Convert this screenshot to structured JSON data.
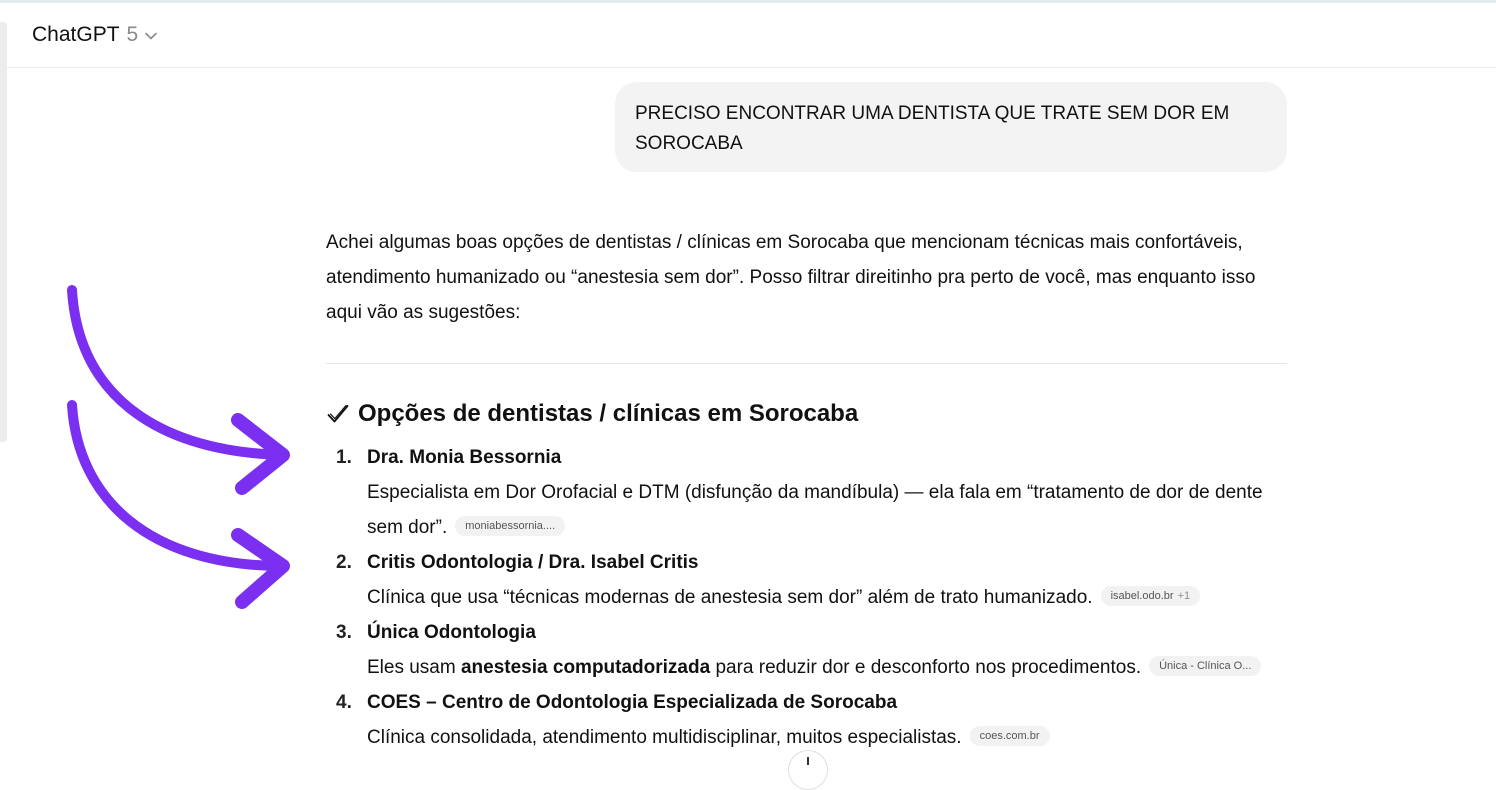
{
  "header": {
    "model_name": "ChatGPT",
    "model_version": "5",
    "dropdown_icon": "chevron-down-icon"
  },
  "conversation": {
    "user_message": "PRECISO ENCONTRAR UMA DENTISTA QUE TRATE SEM DOR EM SOROCABA",
    "intro": "Achei algumas boas opções de dentistas / clínicas em Sorocaba que mencionam técnicas mais confortáveis, atendimento humanizado ou “anestesia sem dor”. Posso filtrar direitinho pra perto de você, mas enquanto isso aqui vão as sugestões:",
    "section_title": "Opções de dentistas / clínicas em Sorocaba",
    "section_icon": "check-icon",
    "items": [
      {
        "number": "1.",
        "name": "Dra. Monia Bessornia",
        "desc": "Especialista em Dor Orofacial e DTM (disfunção da mandíbula) — ela fala em “tratamento de dor de dente sem dor”.",
        "source": "moniabessornia....",
        "source_extra": ""
      },
      {
        "number": "2.",
        "name": "Critis Odontologia / Dra. Isabel Critis",
        "desc": "Clínica que usa “técnicas modernas de anestesia sem dor” além de trato humanizado.",
        "source": "isabel.odo.br",
        "source_extra": "+1"
      },
      {
        "number": "3.",
        "name": "Única Odontologia",
        "desc_before": "Eles usam ",
        "desc_bold": "anestesia computadorizada",
        "desc_after": " para reduzir dor e desconforto nos procedimentos.",
        "source": "Única - Clínica O...",
        "source_extra": ""
      },
      {
        "number": "4.",
        "name": "COES – Centro de Odontologia Especializada de Sorocaba",
        "desc": "Clínica consolidada, atendimento multidisciplinar, muitos especialistas.",
        "source": "coes.com.br",
        "source_extra": ""
      }
    ]
  },
  "annotations": {
    "arrow_color": "#7b2ff0",
    "arrow_icon": "curved-arrow-icon"
  }
}
